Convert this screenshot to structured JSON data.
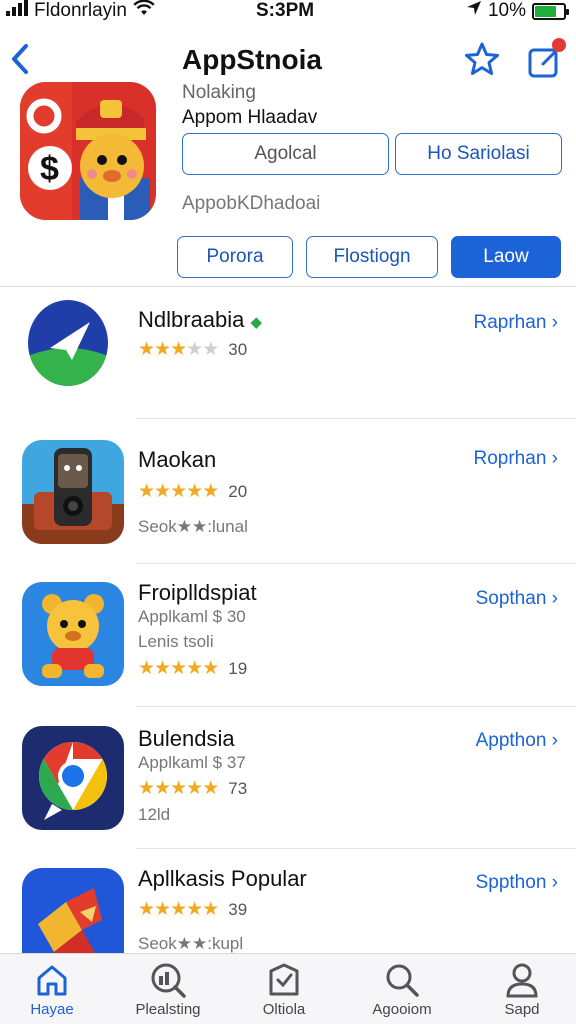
{
  "status": {
    "carrier": "Fldonrlayin",
    "time": "S:3PM",
    "battery": "10%",
    "battery_level": 0.7
  },
  "header": {
    "title": "AppStnoia",
    "subtitle": "Nolaking",
    "subtitle2": "Appom Hlaadav",
    "buttons": [
      "Agolcal",
      "Ho Sariolasi"
    ],
    "meta": "AppobKDhadoai"
  },
  "segments": [
    {
      "label": "Porora",
      "active": false
    },
    {
      "label": "Flostiogn",
      "active": false
    },
    {
      "label": "Laow",
      "active": true
    }
  ],
  "apps": [
    {
      "name": "Ndlbraabia",
      "action": "Raprhan",
      "rating": 2.5,
      "rating_count": "30",
      "lines": [],
      "icon": "paper-plane-icon"
    },
    {
      "name": "Maokan",
      "action": "Roprhan",
      "rating": 4.5,
      "rating_count": "20",
      "lines": [
        "Seok★★:lunal"
      ],
      "icon": "phone-character-icon"
    },
    {
      "name": "Froiplldspiat",
      "action": "Sopthan",
      "rating": 5,
      "rating_count": "19",
      "lines": [
        "Applkaml $ 30",
        "Lenis tsoli"
      ],
      "icon": "bear-character-icon"
    },
    {
      "name": "Bulendsia",
      "action": "Appthon",
      "rating": 5,
      "rating_count": "73",
      "lines": [
        "Applkaml $ 37",
        "12ld"
      ],
      "icon": "chrome-icon"
    },
    {
      "name": "Apllkasis Popular",
      "action": "Sppthon",
      "rating": 4.5,
      "rating_count": "39",
      "lines": [
        "Seok★★:kupl"
      ],
      "icon": "paper-craft-icon"
    }
  ],
  "tabs": [
    {
      "label": "Hayae",
      "icon": "home-icon",
      "active": true
    },
    {
      "label": "Plealsting",
      "icon": "chart-search-icon",
      "active": false
    },
    {
      "label": "Oltiola",
      "icon": "shield-icon",
      "active": false
    },
    {
      "label": "Agooiom",
      "icon": "search-icon",
      "active": false
    },
    {
      "label": "Sapd",
      "icon": "person-icon",
      "active": false
    }
  ],
  "colors": {
    "accent": "#1b63d6",
    "star": "#f2a81f",
    "badge": "#e53935",
    "battery": "#1fae3a"
  }
}
